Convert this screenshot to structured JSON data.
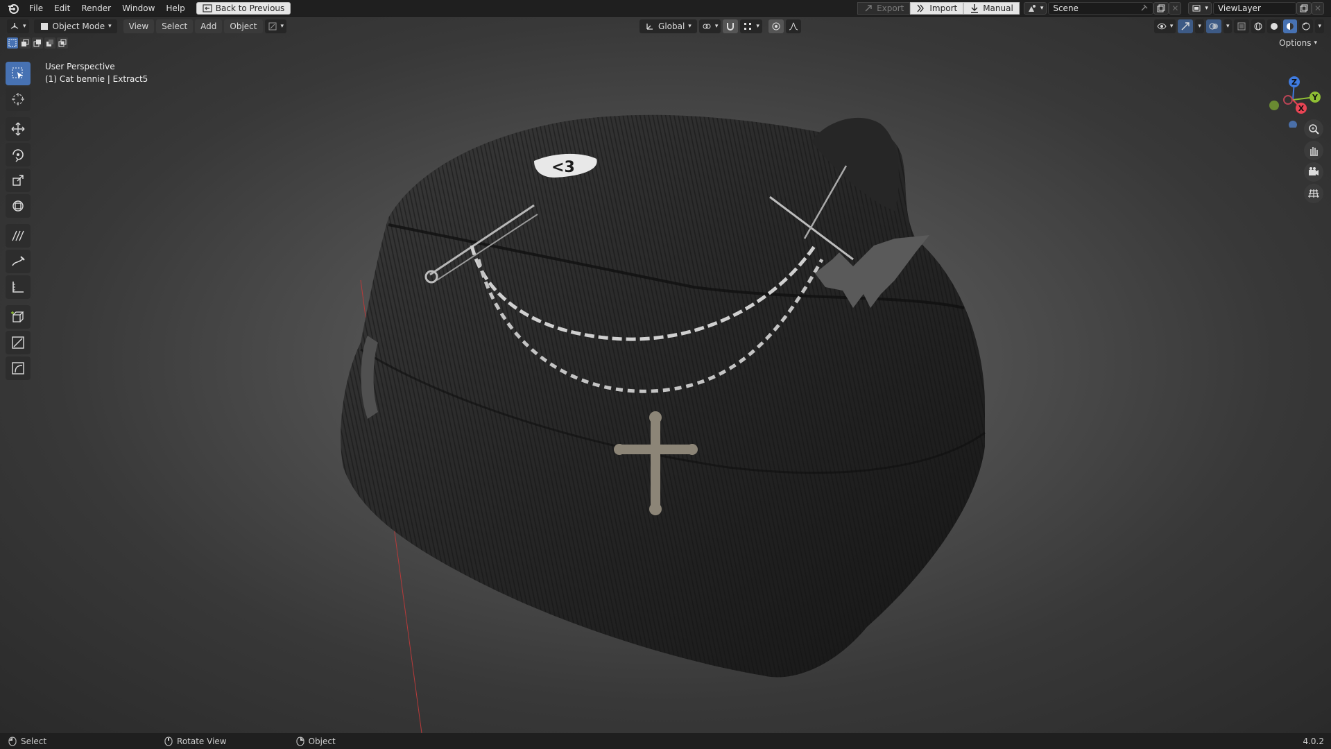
{
  "menu": {
    "file": "File",
    "edit": "Edit",
    "render": "Render",
    "window": "Window",
    "help": "Help",
    "back_button": "Back to Previous"
  },
  "topbar_right": {
    "export": "Export",
    "import": "Import",
    "manual": "Manual",
    "scene_name": "Scene",
    "view_layer": "ViewLayer"
  },
  "header": {
    "mode": "Object Mode",
    "view": "View",
    "select": "Select",
    "add": "Add",
    "object": "Object",
    "transform_orientation": "Global",
    "options": "Options"
  },
  "viewport": {
    "perspective_label": "User Perspective",
    "active_object_label": "(1) Cat bennie | Extract5"
  },
  "gizmo": {
    "z": "Z",
    "y": "Y",
    "x": "X"
  },
  "status": {
    "select": "Select",
    "rotate_view": "Rotate View",
    "object": "Object",
    "version": "4.0.2"
  },
  "colors": {
    "accent": "#4772b3",
    "axis_x": "#e84454",
    "axis_y": "#8fbf34",
    "axis_z": "#3f7be0"
  }
}
